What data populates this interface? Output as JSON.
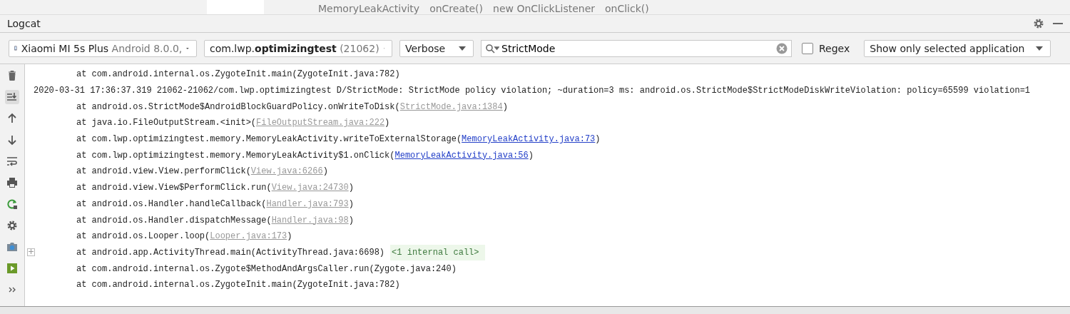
{
  "breadcrumb": [
    "MemoryLeakActivity",
    "onCreate()",
    "new OnClickListener",
    "onClick()"
  ],
  "panel": {
    "title": "Logcat"
  },
  "toolbar": {
    "device": {
      "name": "Xiaomi MI 5s Plus",
      "detail": "Android 8.0.0,"
    },
    "process": {
      "prefix": "com.lwp.",
      "name": "optimizingtest",
      "pid": "(21062)"
    },
    "level": "Verbose",
    "search": {
      "value": "StrictMode"
    },
    "regex": {
      "label": "Regex",
      "checked": false
    },
    "filter": "Show only selected application"
  },
  "lines": [
    {
      "kind": "frame",
      "text": "at com.android.internal.os.ZygoteInit.main(ZygoteInit.java:782)"
    },
    {
      "kind": "header",
      "text": "2020-03-31 17:36:37.319 21062-21062/com.lwp.optimizingtest D/StrictMode: StrictMode policy violation; ~duration=3 ms: android.os.StrictMode$StrictModeDiskWriteViolation: policy=65599 violation=1"
    },
    {
      "kind": "frame",
      "text": "at android.os.StrictMode$AndroidBlockGuardPolicy.onWriteToDisk(",
      "link": "StrictMode.java:1384",
      "active": false,
      "tail": ")"
    },
    {
      "kind": "frame",
      "text": "at java.io.FileOutputStream.<init>(",
      "link": "FileOutputStream.java:222",
      "active": false,
      "tail": ")"
    },
    {
      "kind": "frame",
      "text": "at com.lwp.optimizingtest.memory.MemoryLeakActivity.writeToExternalStorage(",
      "link": "MemoryLeakActivity.java:73",
      "active": true,
      "tail": ")"
    },
    {
      "kind": "frame",
      "text": "at com.lwp.optimizingtest.memory.MemoryLeakActivity$1.onClick(",
      "link": "MemoryLeakActivity.java:56",
      "active": true,
      "tail": ")"
    },
    {
      "kind": "frame",
      "text": "at android.view.View.performClick(",
      "link": "View.java:6266",
      "active": false,
      "tail": ")"
    },
    {
      "kind": "frame",
      "text": "at android.view.View$PerformClick.run(",
      "link": "View.java:24730",
      "active": false,
      "tail": ")"
    },
    {
      "kind": "frame",
      "text": "at android.os.Handler.handleCallback(",
      "link": "Handler.java:793",
      "active": false,
      "tail": ")"
    },
    {
      "kind": "frame",
      "text": "at android.os.Handler.dispatchMessage(",
      "link": "Handler.java:98",
      "active": false,
      "tail": ")"
    },
    {
      "kind": "frame",
      "text": "at android.os.Looper.loop(",
      "link": "Looper.java:173",
      "active": false,
      "tail": ")"
    },
    {
      "kind": "frame",
      "text": "at android.app.ActivityThread.main(ActivityThread.java:6698)",
      "folded": "<1 internal call>",
      "expanded": false
    },
    {
      "kind": "frame",
      "text": "at com.android.internal.os.Zygote$MethodAndArgsCaller.run(Zygote.java:240)"
    },
    {
      "kind": "frame",
      "text": "at com.android.internal.os.ZygoteInit.main(ZygoteInit.java:782)"
    }
  ]
}
